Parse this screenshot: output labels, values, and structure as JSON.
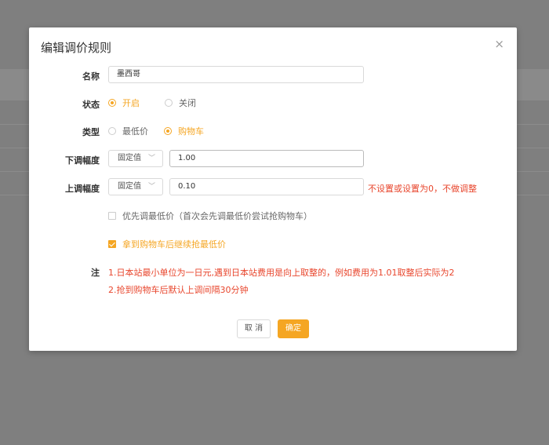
{
  "dialog": {
    "title": "编辑调价规则",
    "close_glyph": "×"
  },
  "form": {
    "name": {
      "label": "名称",
      "value": "墨西哥"
    },
    "status": {
      "label": "状态",
      "options": [
        {
          "label": "开启",
          "selected": true
        },
        {
          "label": "关闭",
          "selected": false
        }
      ]
    },
    "type": {
      "label": "类型",
      "options": [
        {
          "label": "最低价",
          "selected": false
        },
        {
          "label": "购物车",
          "selected": true
        }
      ]
    },
    "down_range": {
      "label": "下调幅度",
      "select_value": "固定值",
      "value": "1.00"
    },
    "up_range": {
      "label": "上调幅度",
      "select_value": "固定值",
      "value": "0.10",
      "hint": "不设置或设置为0，不做调整"
    },
    "checkbox_priority": {
      "label": "优先调最低价（首次会先调最低价尝试抢购物车）",
      "checked": false
    },
    "checkbox_continue": {
      "label": "拿到购物车后继续抢最低价",
      "checked": true
    },
    "note": {
      "label": "注",
      "lines": [
        "1.日本站最小单位为一日元,遇到日本站费用是向上取整的，例如费用为1.01取整后实际为2",
        "2.抢到购物车后默认上调间隔30分钟"
      ]
    }
  },
  "buttons": {
    "cancel": "取 消",
    "ok": "确定"
  },
  "colors": {
    "accent": "#f5a623",
    "warning": "#e8462d",
    "overlay": "#7f7f7f"
  },
  "icons": {
    "chevron": "chevron-down-icon",
    "close": "close-icon"
  }
}
